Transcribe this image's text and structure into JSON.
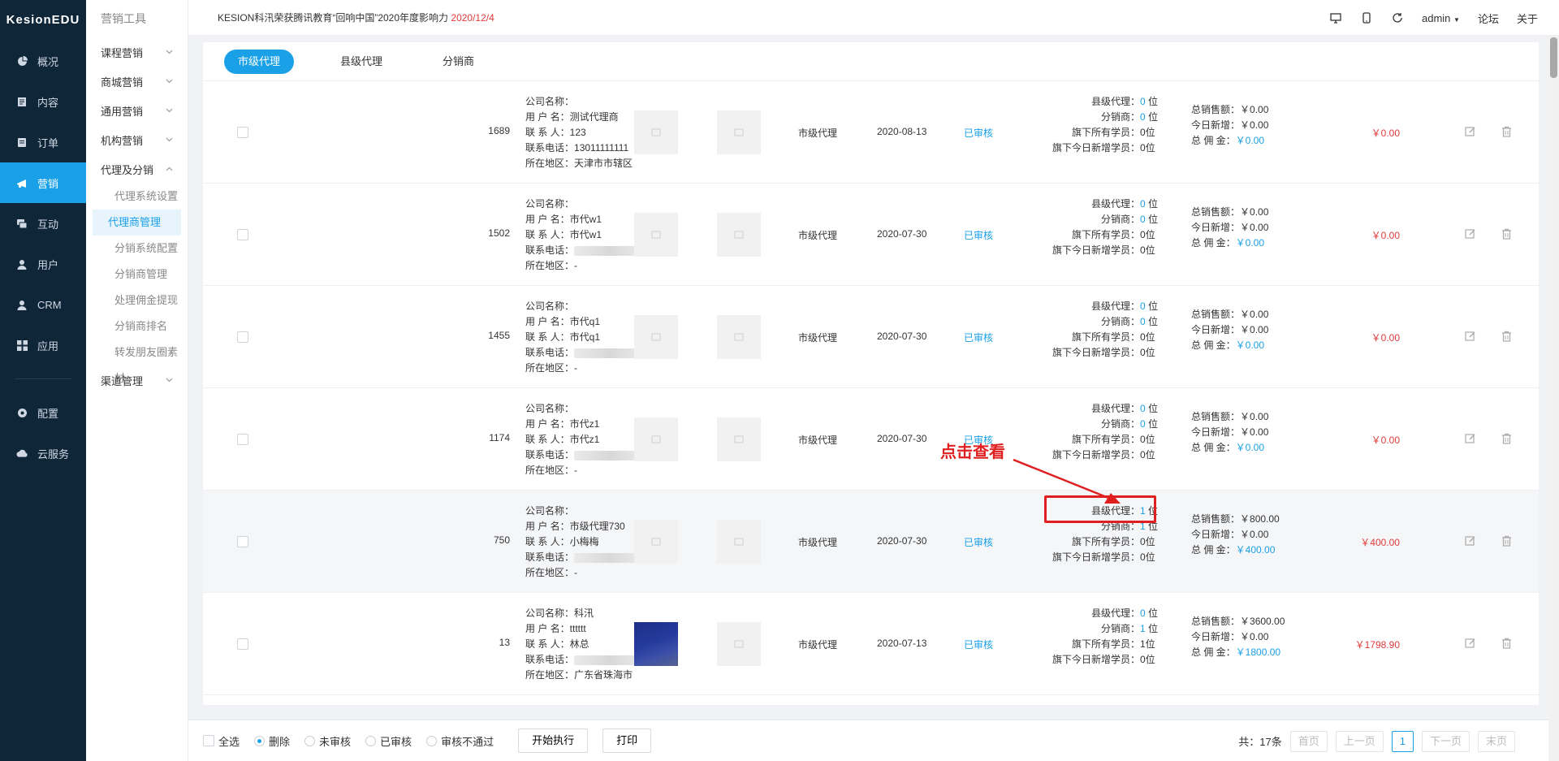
{
  "brand": "KesionEDU",
  "nav": [
    {
      "label": "概况",
      "icon": "dashboard-icon"
    },
    {
      "label": "内容",
      "icon": "document-icon"
    },
    {
      "label": "订单",
      "icon": "order-icon"
    },
    {
      "label": "营销",
      "icon": "marketing-icon",
      "active": true
    },
    {
      "label": "互动",
      "icon": "chat-icon"
    },
    {
      "label": "用户",
      "icon": "user-icon"
    },
    {
      "label": "CRM",
      "icon": "crm-icon"
    },
    {
      "label": "应用",
      "icon": "apps-icon"
    }
  ],
  "nav_bottom": [
    {
      "label": "配置",
      "icon": "settings-icon"
    },
    {
      "label": "云服务",
      "icon": "cloud-icon"
    }
  ],
  "subnav": {
    "title": "营销工具",
    "groups_top": [
      "课程营销",
      "商城营销",
      "通用营销",
      "机构营销"
    ],
    "expanded_group": "代理及分销",
    "items": [
      "代理系统设置",
      "代理商管理",
      "分销系统配置",
      "分销商管理",
      "处理佣金提现",
      "分销商排名",
      "转发朋友圈素材"
    ],
    "active_item": "代理商管理",
    "groups_bottom": [
      "渠道管理"
    ]
  },
  "topbar": {
    "notice": "KESION科汛荣获腾讯教育“回响中国”2020年度影响力",
    "notice_date": "2020/12/4",
    "user": "admin",
    "links": [
      "论坛",
      "关于"
    ]
  },
  "tabs": [
    "市级代理",
    "县级代理",
    "分销商"
  ],
  "labels": {
    "company": "公司名称：",
    "username": "用 户 名：",
    "contact": "联 系 人：",
    "phone": "联系电话：",
    "area": "所在地区：",
    "county": "县级代理：",
    "distributor": "分销商：",
    "members": "旗下所有学员：",
    "new_members": "旗下今日新增学员：",
    "total_sales": "总销售额：",
    "today_new": "今日新增：",
    "commission": "总 佣 金："
  },
  "rows": [
    {
      "id": "1689",
      "company": "",
      "username": "测试代理商",
      "contact": "123",
      "phone": "13011111111",
      "area": "天津市市辖区",
      "thumb_dark": false,
      "level": "市级代理",
      "date": "2020-08-13",
      "status": "已审核",
      "county": "0",
      "distributor": "0",
      "members": "0位",
      "new_members": "0位",
      "total_sales": "￥0.00",
      "today_new": "￥0.00",
      "commission": "￥0.00",
      "amount": "￥0.00"
    },
    {
      "id": "1502",
      "company": "",
      "username": "市代w1",
      "contact": "市代w1",
      "phone": "",
      "area": "-",
      "thumb_dark": false,
      "level": "市级代理",
      "date": "2020-07-30",
      "status": "已审核",
      "county": "0",
      "distributor": "0",
      "members": "0位",
      "new_members": "0位",
      "total_sales": "￥0.00",
      "today_new": "￥0.00",
      "commission": "￥0.00",
      "amount": "￥0.00"
    },
    {
      "id": "1455",
      "company": "",
      "username": "市代q1",
      "contact": "市代q1",
      "phone": "",
      "area": "-",
      "thumb_dark": false,
      "level": "市级代理",
      "date": "2020-07-30",
      "status": "已审核",
      "county": "0",
      "distributor": "0",
      "members": "0位",
      "new_members": "0位",
      "total_sales": "￥0.00",
      "today_new": "￥0.00",
      "commission": "￥0.00",
      "amount": "￥0.00"
    },
    {
      "id": "1174",
      "company": "",
      "username": "市代z1",
      "contact": "市代z1",
      "phone": "",
      "area": "-",
      "thumb_dark": false,
      "level": "市级代理",
      "date": "2020-07-30",
      "status": "已审核",
      "county": "0",
      "distributor": "0",
      "members": "0位",
      "new_members": "0位",
      "total_sales": "￥0.00",
      "today_new": "￥0.00",
      "commission": "￥0.00",
      "amount": "￥0.00"
    },
    {
      "id": "750",
      "company": "",
      "username": "市级代理730",
      "contact": "小梅梅",
      "phone": "",
      "area": "-",
      "thumb_dark": false,
      "level": "市级代理",
      "date": "2020-07-30",
      "status": "已审核",
      "county": "1",
      "distributor": "1",
      "members": "0位",
      "new_members": "0位",
      "total_sales": "￥800.00",
      "today_new": "￥0.00",
      "commission": "￥400.00",
      "amount": "￥400.00",
      "highlight": true
    },
    {
      "id": "13",
      "company": "科汛",
      "username": "tttttt",
      "contact": "林总",
      "phone": "",
      "area": "广东省珠海市",
      "thumb_dark": true,
      "level": "市级代理",
      "date": "2020-07-13",
      "status": "已审核",
      "county": "0",
      "distributor": "1",
      "members": "1位",
      "new_members": "0位",
      "total_sales": "￥3600.00",
      "today_new": "￥0.00",
      "commission": "￥1800.00",
      "amount": "￥1798.90"
    }
  ],
  "unit_wei": "位",
  "annotation": "点击查看",
  "bottom": {
    "select_all": "全选",
    "actions": [
      "删除",
      "未审核",
      "已审核",
      "审核不通过"
    ],
    "selected_action": "删除",
    "execute": "开始执行",
    "print": "打印",
    "total": "共：17条",
    "first": "首页",
    "prev": "上一页",
    "page": "1",
    "next": "下一页",
    "last": "末页"
  },
  "colors": {
    "accent": "#1aa0e6",
    "danger": "#e03a3a",
    "sidebar": "#0f2538"
  }
}
